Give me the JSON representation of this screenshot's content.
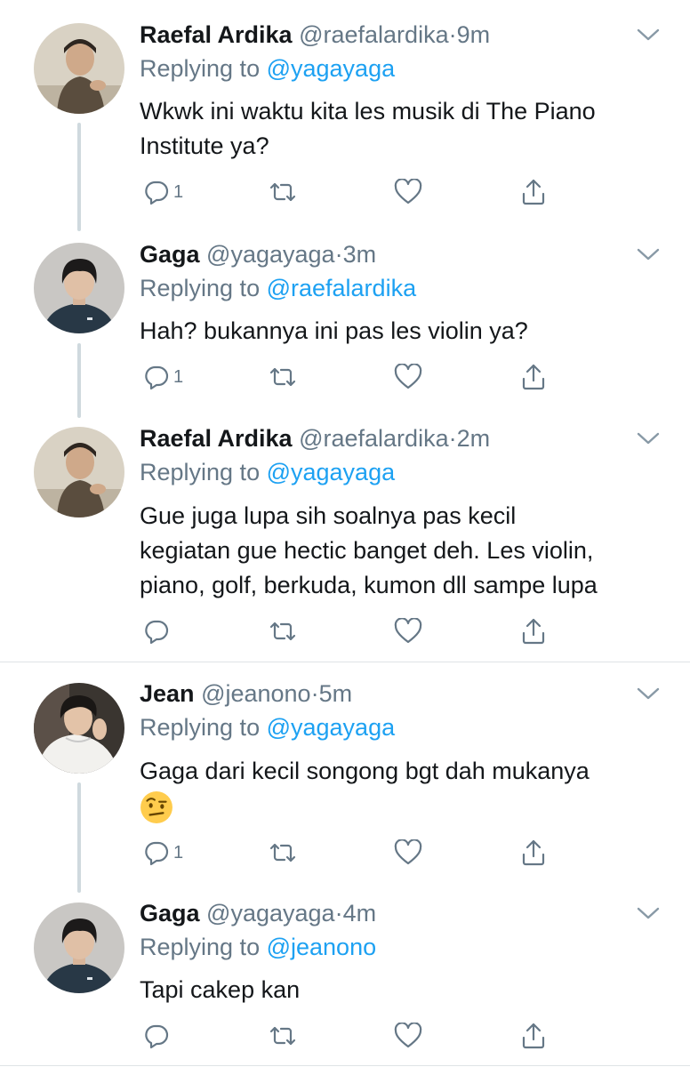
{
  "tweets": [
    {
      "name": "Raefal Ardika",
      "handle": "@raefalardika",
      "separator": "·",
      "time": "9m",
      "replying_prefix": "Replying to ",
      "replying_to": "@yagayaga",
      "text_lines": [
        "Wkwk ini waktu kita les musik di The Piano",
        "Institute ya?"
      ],
      "reply_count": "1",
      "avatar": "raefal-avatar"
    },
    {
      "name": "Gaga",
      "handle": "@yagayaga",
      "separator": "·",
      "time": "3m",
      "replying_prefix": "Replying to ",
      "replying_to": "@raefalardika",
      "text_lines": [
        "Hah? bukannya ini pas les violin ya?"
      ],
      "reply_count": "1",
      "avatar": "gaga-avatar"
    },
    {
      "name": "Raefal Ardika",
      "handle": "@raefalardika",
      "separator": "·",
      "time": "2m",
      "replying_prefix": "Replying to ",
      "replying_to": "@yagayaga",
      "text_lines": [
        "Gue juga lupa sih soalnya pas kecil",
        "kegiatan gue hectic banget deh. Les violin,",
        "piano, golf, berkuda, kumon dll sampe lupa"
      ],
      "reply_count": "",
      "avatar": "raefal-avatar"
    },
    {
      "name": "Jean",
      "handle": "@jeanono",
      "separator": "·",
      "time": "5m",
      "replying_prefix": "Replying to ",
      "replying_to": "@yagayaga",
      "text_lines": [
        "Gaga dari kecil songong bgt dah mukanya"
      ],
      "emoji": "face-with-raised-eyebrow",
      "reply_count": "1",
      "avatar": "jean-avatar"
    },
    {
      "name": "Gaga",
      "handle": "@yagayaga",
      "separator": "·",
      "time": "4m",
      "replying_prefix": "Replying to ",
      "replying_to": "@jeanono",
      "text_lines": [
        "Tapi cakep kan"
      ],
      "reply_count": "",
      "avatar": "gaga-avatar"
    }
  ],
  "icons": {
    "reply": "reply-icon",
    "retweet": "retweet-icon",
    "like": "like-icon",
    "share": "share-icon",
    "more": "chevron-down-icon"
  },
  "colors": {
    "text": "#14171a",
    "secondary": "#657786",
    "link": "#1da1f2",
    "thread_line": "#cfd9de",
    "divider": "#dfe3e6"
  }
}
